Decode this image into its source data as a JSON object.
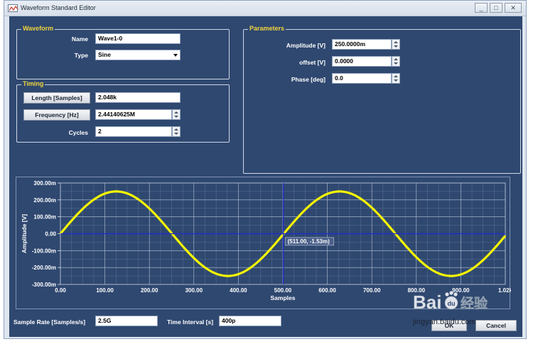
{
  "window": {
    "title": "Waveform Standard Editor",
    "minimize_glyph": "_",
    "maximize_glyph": "□",
    "close_glyph": "✕"
  },
  "waveform": {
    "group_title": "Waveform",
    "name_label": "Name",
    "name_value": "Wave1-0",
    "type_label": "Type",
    "type_value": "Sine"
  },
  "timing": {
    "group_title": "Timing",
    "length_button": "Length [Samples]",
    "length_value": "2.048k",
    "frequency_button": "Frequency [Hz]",
    "frequency_value": "2.44140625M",
    "cycles_label": "Cycles",
    "cycles_value": "2"
  },
  "parameters": {
    "group_title": "Parameters",
    "amplitude_label": "Amplitude [V]",
    "amplitude_value": "250.0000m",
    "offset_label": "offset [V]",
    "offset_value": "0.0000",
    "phase_label": "Phase [deg]",
    "phase_value": "0.0"
  },
  "chart_data": {
    "type": "line",
    "title": "",
    "xlabel": "Samples",
    "ylabel": "Amplitude [V]",
    "xlim": [
      0,
      1020
    ],
    "ylim": [
      -300,
      300
    ],
    "x_ticks": [
      "0.00",
      "100.00",
      "200.00",
      "300.00",
      "400.00",
      "500.00",
      "600.00",
      "700.00",
      "800.00",
      "900.00",
      "1.02k"
    ],
    "y_ticks": [
      "300.00m",
      "200.00m",
      "100.00m",
      "0.00",
      "-100.00m",
      "-200.00m",
      "-300.00m"
    ],
    "series": [
      {
        "amplitude_mV": 250,
        "period_samples": 512,
        "color": "#f5f500",
        "x": [
          0,
          64,
          128,
          192,
          256,
          320,
          384,
          448,
          512,
          576,
          640,
          704,
          768,
          832,
          896,
          960,
          1020
        ],
        "y": [
          0,
          176.8,
          250,
          176.8,
          0,
          -176.8,
          -250,
          -176.8,
          0,
          176.8,
          250,
          176.8,
          0,
          -176.8,
          -250,
          -176.8,
          -6.1
        ]
      }
    ],
    "cursor": {
      "x": 511,
      "y": -1.53,
      "label": "(511.00, -1.53m)"
    },
    "grid": true,
    "colors": {
      "background": "#2f4870",
      "plot_area": "#2f4870",
      "grid": "#b9c4d6",
      "axis_line": "#1f2ad8",
      "cursor": "#1f2ad8",
      "trace": "#f5f500"
    }
  },
  "footer": {
    "sample_rate_label": "Sample Rate [Samples/s]",
    "sample_rate_value": "2.5G",
    "time_interval_label": "Time Interval [s]",
    "time_interval_value": "400p",
    "ok_label": "OK",
    "cancel_label": "Cancel"
  },
  "watermark": {
    "brand": "Bai",
    "paw": "du",
    "suffix": "经验",
    "url": "jingyan.baidu.com"
  }
}
